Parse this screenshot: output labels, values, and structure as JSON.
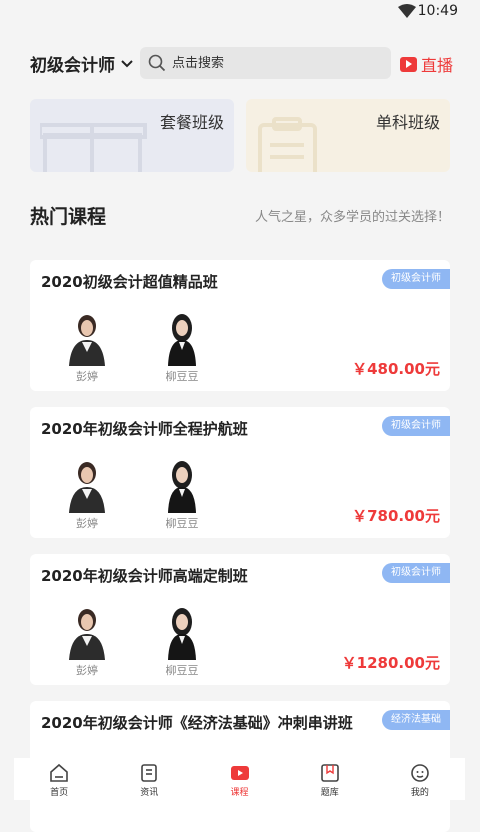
{
  "status_bar": {
    "time": "10:49"
  },
  "header": {
    "category": "初级会计师",
    "search_placeholder": "点击搜索",
    "live_label": "直播"
  },
  "banners": [
    {
      "label": "套餐班级"
    },
    {
      "label": "单科班级"
    }
  ],
  "section": {
    "title": "热门课程",
    "subtitle": "人气之星，众多学员的过关选择！"
  },
  "courses": [
    {
      "title": "2020初级会计超值精品班",
      "tag": "初级会计师",
      "teachers": [
        "彭婷",
        "柳豆豆"
      ],
      "price": "￥480.00元"
    },
    {
      "title": "2020年初级会计师全程护航班",
      "tag": "初级会计师",
      "teachers": [
        "彭婷",
        "柳豆豆"
      ],
      "price": "￥780.00元"
    },
    {
      "title": "2020年初级会计师高端定制班",
      "tag": "初级会计师",
      "teachers": [
        "彭婷",
        "柳豆豆"
      ],
      "price": "￥1280.00元"
    },
    {
      "title": "2020年初级会计师《经济法基础》冲刺串讲班",
      "tag": "经济法基础"
    }
  ],
  "tabbar": {
    "items": [
      {
        "label": "首页",
        "icon": "home-icon"
      },
      {
        "label": "资讯",
        "icon": "news-icon"
      },
      {
        "label": "课程",
        "icon": "course-icon"
      },
      {
        "label": "题库",
        "icon": "question-bank-icon"
      },
      {
        "label": "我的",
        "icon": "profile-icon"
      }
    ],
    "active_index": 2
  },
  "colors": {
    "accent": "#ee3a3a",
    "tag": "#8fb7f3"
  }
}
